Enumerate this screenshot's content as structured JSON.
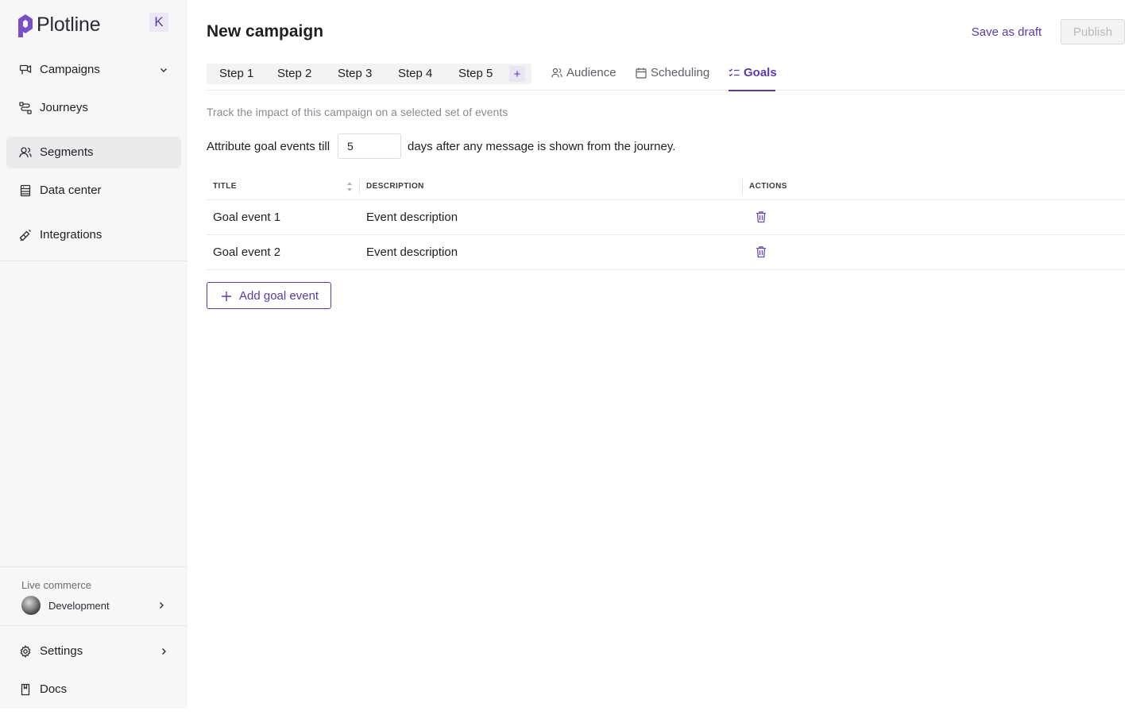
{
  "brand": {
    "name": "Plotline",
    "accent": "#5b3aa6",
    "logo_color": "#7a4fc9"
  },
  "sidebar": {
    "collapse_glyph": "K",
    "items": [
      {
        "label": "Campaigns",
        "icon": "campaigns-icon",
        "has_dropdown": true
      },
      {
        "label": "Journeys",
        "icon": "journeys-icon"
      },
      {
        "label": "Segments",
        "icon": "segments-icon",
        "active": true
      },
      {
        "label": "Data center",
        "icon": "data-center-icon"
      },
      {
        "label": "Integrations",
        "icon": "integrations-icon"
      }
    ],
    "org": {
      "label": "Live commerce",
      "environment": "Development"
    },
    "footer": [
      {
        "label": "Settings",
        "icon": "gear-icon"
      },
      {
        "label": "Docs",
        "icon": "docs-icon"
      }
    ]
  },
  "header": {
    "title": "New campaign",
    "save_draft": "Save as draft",
    "publish": "Publish"
  },
  "tabs": {
    "steps": [
      "Step 1",
      "Step 2",
      "Step 3",
      "Step 4",
      "Step 5"
    ],
    "add_step": "+",
    "sections": [
      {
        "label": "Audience",
        "icon": "audience-icon"
      },
      {
        "label": "Scheduling",
        "icon": "calendar-icon"
      },
      {
        "label": "Goals",
        "icon": "goals-checklist-icon",
        "active": true
      }
    ]
  },
  "goals": {
    "subtitle": "Track the impact of this campaign on a selected set of events",
    "attribute_prefix": "Attribute goal events till",
    "attribute_days": "5",
    "attribute_suffix": "days after any message is shown from the journey.",
    "columns": [
      "TITLE",
      "DESCRIPTION",
      "ACTIONS"
    ],
    "rows": [
      {
        "title": "Goal event 1",
        "description": "Event description"
      },
      {
        "title": "Goal event 2",
        "description": "Event description"
      }
    ],
    "add_button": "Add goal event"
  }
}
